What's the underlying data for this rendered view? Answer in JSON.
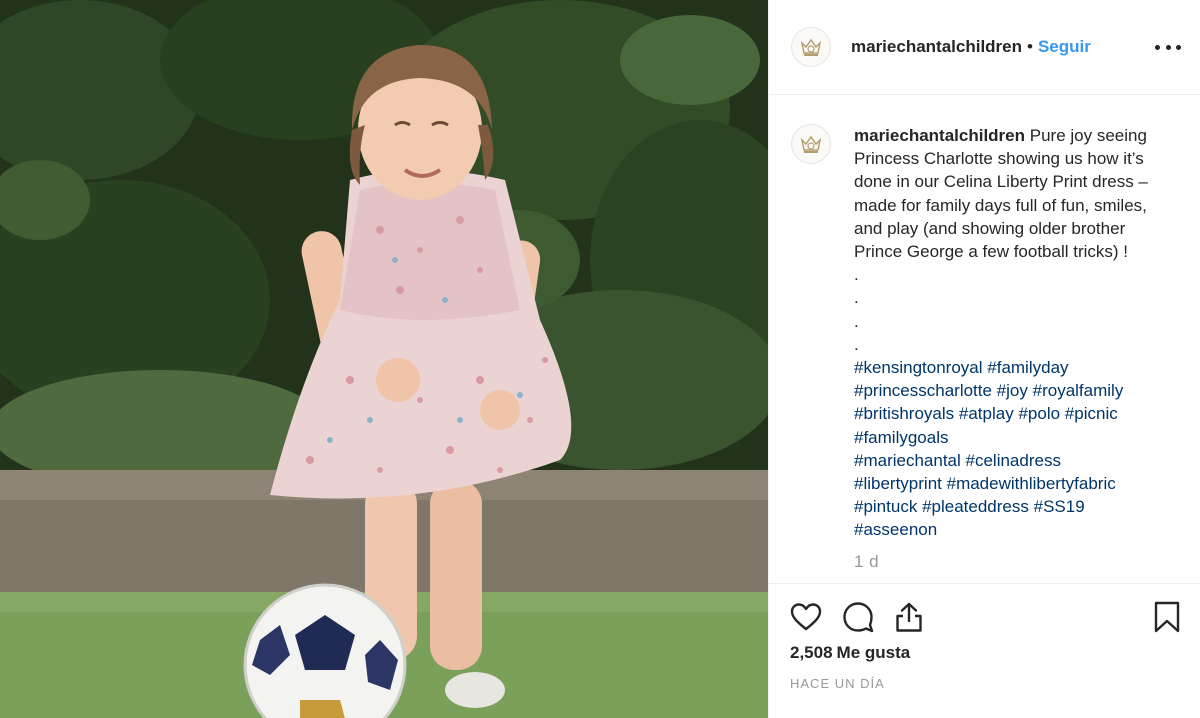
{
  "post": {
    "photo_alt": "",
    "account": {
      "username": "mariechantalchildren",
      "separator": "•",
      "follow_label": "Seguir",
      "avatar_icon": "crown-logo-icon"
    },
    "caption": {
      "username": "mariechantalchildren",
      "text_lines": [
        "Pure joy seeing",
        "Princess Charlotte showing us how it’s",
        "done in our Celina Liberty Print dress –",
        "made for family days full of fun, smiles,",
        "and play (and showing older brother",
        "Prince George a few football tricks) !"
      ],
      "dots": [
        ".",
        ".",
        ".",
        "."
      ],
      "hashtag_lines": [
        [
          "#kensingtonroyal",
          "#familyday"
        ],
        [
          "#princesscharlotte",
          "#joy",
          "#royalfamily"
        ],
        [
          "#britishroyals",
          "#atplay",
          "#polo",
          "#picnic"
        ],
        [
          "#familygoals"
        ],
        [
          "#mariechantal",
          "#celinadress"
        ],
        [
          "#libertyprint",
          "#madewithlibertyfabric"
        ],
        [
          "#pintuck",
          "#pleateddress",
          "#SS19"
        ],
        [
          "#asseenon"
        ]
      ],
      "time": "1 d"
    },
    "actions": {
      "like_icon": "heart-icon",
      "comment_icon": "comment-icon",
      "share_icon": "share-icon",
      "save_icon": "bookmark-icon"
    },
    "likes": {
      "count": "2,508",
      "label": "Me gusta"
    },
    "posted": "HACE UN DÍA",
    "colors": {
      "link": "#003569",
      "follow": "#3897f0",
      "text": "#262626",
      "muted": "#999999"
    }
  }
}
